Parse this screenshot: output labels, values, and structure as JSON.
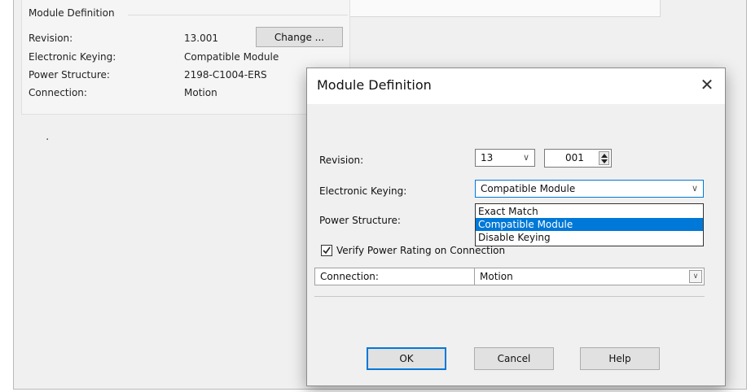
{
  "background": {
    "group_title": "Module Definition",
    "rows": [
      {
        "label": "Revision:",
        "value": "13.001"
      },
      {
        "label": "Electronic Keying:",
        "value": "Compatible Module"
      },
      {
        "label": "Power Structure:",
        "value": "2198-C1004-ERS"
      },
      {
        "label": "Connection:",
        "value": "Motion"
      }
    ],
    "change_label": "Change ...",
    "dot": "."
  },
  "dialog": {
    "title": "Module Definition",
    "close_glyph": "✕",
    "revision_label": "Revision:",
    "revision_major": "13",
    "revision_minor": "001",
    "keying_label": "Electronic Keying:",
    "keying_value": "Compatible Module",
    "keying_options": [
      "Exact Match",
      "Compatible Module",
      "Disable Keying"
    ],
    "keying_selected_index": 1,
    "power_label": "Power Structure:",
    "verify_label": "Verify Power Rating on Connection",
    "verify_checked": true,
    "connection_label": "Connection:",
    "connection_value": "Motion",
    "ok_label": "OK",
    "cancel_label": "Cancel",
    "help_label": "Help"
  },
  "colors": {
    "accent": "#0078d7",
    "panel": "#f0f0f0"
  },
  "icons": [
    "close-icon",
    "chevron-down-icon",
    "spinner-up-icon",
    "spinner-down-icon",
    "checkmark-icon"
  ]
}
